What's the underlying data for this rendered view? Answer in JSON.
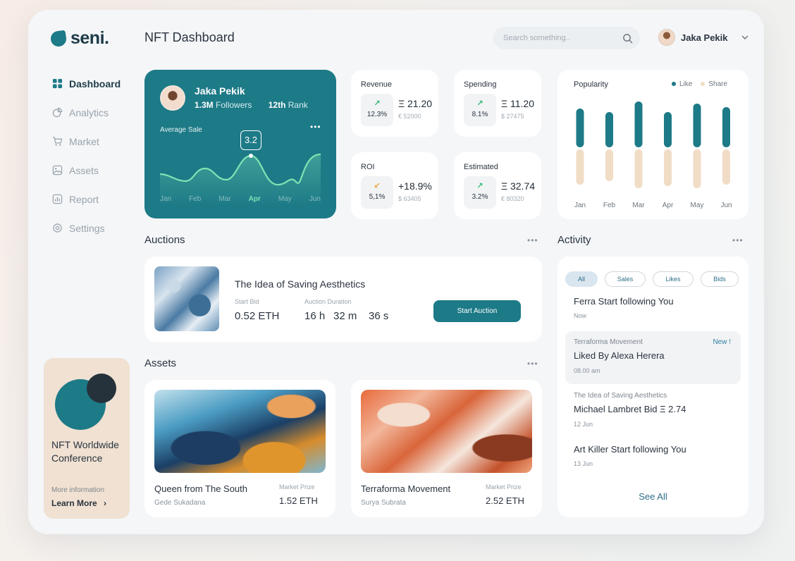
{
  "app": {
    "logo": "seni.",
    "title": "NFT Dashboard"
  },
  "search": {
    "placeholder": "Search something.."
  },
  "user": {
    "name": "Jaka Pekik"
  },
  "nav": [
    {
      "label": "Dashboard",
      "icon": "grid-icon",
      "active": true
    },
    {
      "label": "Analytics",
      "icon": "pie-chart-icon"
    },
    {
      "label": "Market",
      "icon": "cart-icon"
    },
    {
      "label": "Assets",
      "icon": "image-icon"
    },
    {
      "label": "Report",
      "icon": "bar-chart-icon"
    },
    {
      "label": "Settings",
      "icon": "gear-icon"
    }
  ],
  "promo": {
    "title": "NFT Worldwide Conference",
    "info": "More information",
    "link": "Learn More"
  },
  "profile": {
    "name": "Jaka Pekik",
    "followers_value": "1.3M",
    "followers_label": "Followers",
    "rank_value": "12th",
    "rank_label": "Rank",
    "chart_label": "Average Sale",
    "tooltip": "3.2",
    "months": [
      "Jan",
      "Feb",
      "Mar",
      "Apr",
      "May",
      "Jun"
    ],
    "active_month": "Apr"
  },
  "stats": [
    {
      "label": "Revenue",
      "pct": "12.3%",
      "value": "Ξ 21.20",
      "sub": "€ 52000",
      "trend": "up"
    },
    {
      "label": "Spending",
      "pct": "8.1%",
      "value": "Ξ 11.20",
      "sub": "$ 27475",
      "trend": "up"
    },
    {
      "label": "ROI",
      "pct": "5,1%",
      "value": "+18.9%",
      "sub": "$ 63405",
      "trend": "down"
    },
    {
      "label": "Estimated",
      "pct": "3.2%",
      "value": "Ξ 32.74",
      "sub": "€ 80320",
      "trend": "up"
    }
  ],
  "colors": {
    "accent": "#1d7a87",
    "like": "#1d7a87",
    "share": "#f1dcc6",
    "up": "#2bb673",
    "down": "#f0a030"
  },
  "chart_data": {
    "type": "bar",
    "title": "Popularity",
    "categories": [
      "Jan",
      "Feb",
      "Mar",
      "Apr",
      "May",
      "Jun"
    ],
    "series": [
      {
        "name": "Like",
        "values": [
          0.55,
          0.5,
          0.65,
          0.5,
          0.62,
          0.57
        ]
      },
      {
        "name": "Share",
        "values": [
          0.5,
          0.45,
          0.55,
          0.52,
          0.55,
          0.5
        ]
      }
    ],
    "legend": "top-right",
    "grid": false
  },
  "auctions": {
    "title": "Auctions",
    "item": {
      "title": "The Idea of Saving Aesthetics",
      "bid_label": "Start Bid",
      "bid_value": "0.52 ETH",
      "duration_label": "Auction Duration",
      "hours": "16 h",
      "minutes": "32 m",
      "seconds": "36 s",
      "button": "Start Auction"
    }
  },
  "assets": {
    "title": "Assets",
    "items": [
      {
        "name": "Queen from The South",
        "author": "Gede Sukadana",
        "price_label": "Market Prize",
        "price": "1.52 ETH"
      },
      {
        "name": "Terraforma Movement",
        "author": "Surya Subrata",
        "price_label": "Market Prize",
        "price": "2.52 ETH"
      }
    ]
  },
  "activity": {
    "title": "Activity",
    "filters": [
      "All",
      "Sales",
      "Likes",
      "Bids"
    ],
    "items": [
      {
        "context": "",
        "text": "Ferra Start following You",
        "time": "Now",
        "badge": ""
      },
      {
        "context": "Terraforma Movement",
        "text": "Liked By Alexa Herera",
        "time": "08.00 am",
        "badge": "New !"
      },
      {
        "context": "The Idea of Saving Aesthetics",
        "text": "Michael Lambret Bid Ξ 2.74",
        "time": "12 Jun",
        "badge": ""
      },
      {
        "context": "",
        "text": "Art Killer Start following You",
        "time": "13 Jun",
        "badge": ""
      }
    ],
    "see_all": "See All"
  }
}
